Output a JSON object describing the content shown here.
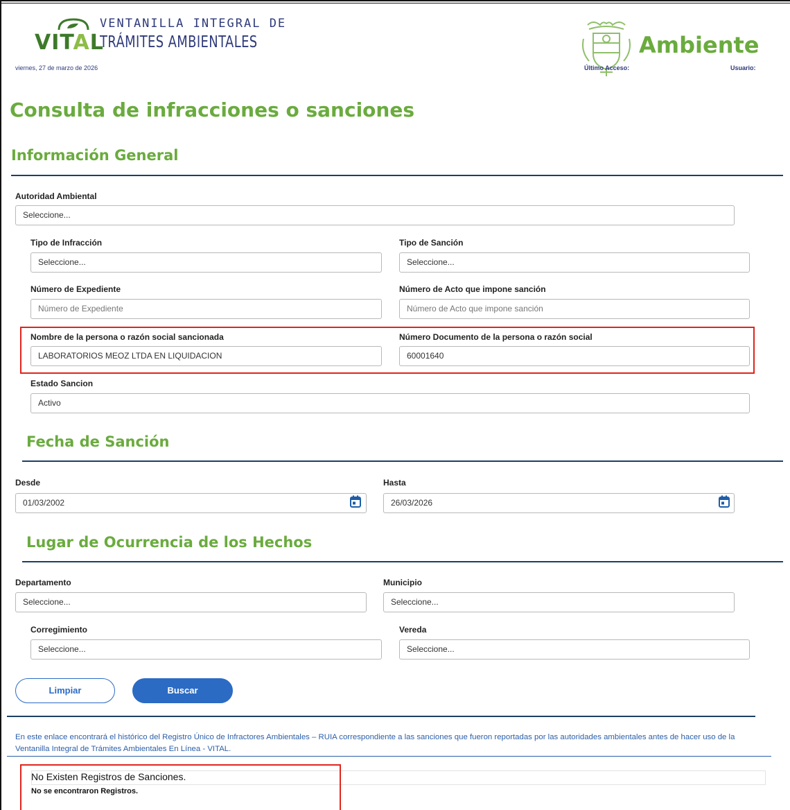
{
  "header": {
    "logo_word": "VITAL",
    "logo_line1": "VENTANILLA INTEGRAL DE",
    "logo_line2": "TRÁMITES AMBIENTALES",
    "date": "viernes, 27 de marzo de 2026",
    "brand": "Ambiente",
    "last_access_label": "Último Acceso:",
    "user_label": "Usuario:"
  },
  "page_title": "Consulta de infracciones o sanciones",
  "general": {
    "section_title": "Información General",
    "autoridad_label": "Autoridad Ambiental",
    "autoridad_value": "Seleccione...",
    "tipo_infraccion_label": "Tipo de Infracción",
    "tipo_infraccion_value": "Seleccione...",
    "tipo_sancion_label": "Tipo de Sanción",
    "tipo_sancion_value": "Seleccione...",
    "expediente_label": "Número de Expediente",
    "expediente_placeholder": "Número de Expediente",
    "acto_label": "Número de Acto que impone sanción",
    "acto_placeholder": "Número de Acto que impone sanción",
    "nombre_label": "Nombre de la persona o razón social sancionada",
    "nombre_value": "LABORATORIOS MEOZ LTDA EN LIQUIDACION",
    "documento_label": "Número Documento de la persona o razón social",
    "documento_value": "60001640",
    "estado_label": "Estado Sancion",
    "estado_value": "Activo"
  },
  "fecha": {
    "section_title": "Fecha de Sanción",
    "desde_label": "Desde",
    "desde_value": "01/03/2002",
    "hasta_label": "Hasta",
    "hasta_value": "26/03/2026"
  },
  "lugar": {
    "section_title": "Lugar de Ocurrencia de los Hechos",
    "departamento_label": "Departamento",
    "departamento_value": "Seleccione...",
    "municipio_label": "Municipio",
    "municipio_value": "Seleccione...",
    "corregimiento_label": "Corregimiento",
    "corregimiento_value": "Seleccione...",
    "vereda_label": "Vereda",
    "vereda_value": "Seleccione..."
  },
  "buttons": {
    "limpiar": "Limpiar",
    "buscar": "Buscar"
  },
  "info_link": "En este enlace encontrará el histórico del Registro Único de Infractores Ambientales – RUIA correspondiente a las sanciones que fueron reportadas por las autoridades ambientales antes de hacer uso de la Ventanilla Integral de Trámites Ambientales En Línea - VITAL.",
  "results": {
    "no_exist": "No Existen Registros de Sanciones.",
    "no_found": "No se encontraron Registros."
  },
  "colors": {
    "green": "#6aab3e",
    "navy": "#1b3f63",
    "blue": "#2b6bc4",
    "highlight": "#e0241b"
  },
  "icons": [
    "leaf-logo-icon",
    "coat-of-arms-icon",
    "calendar-icon"
  ]
}
